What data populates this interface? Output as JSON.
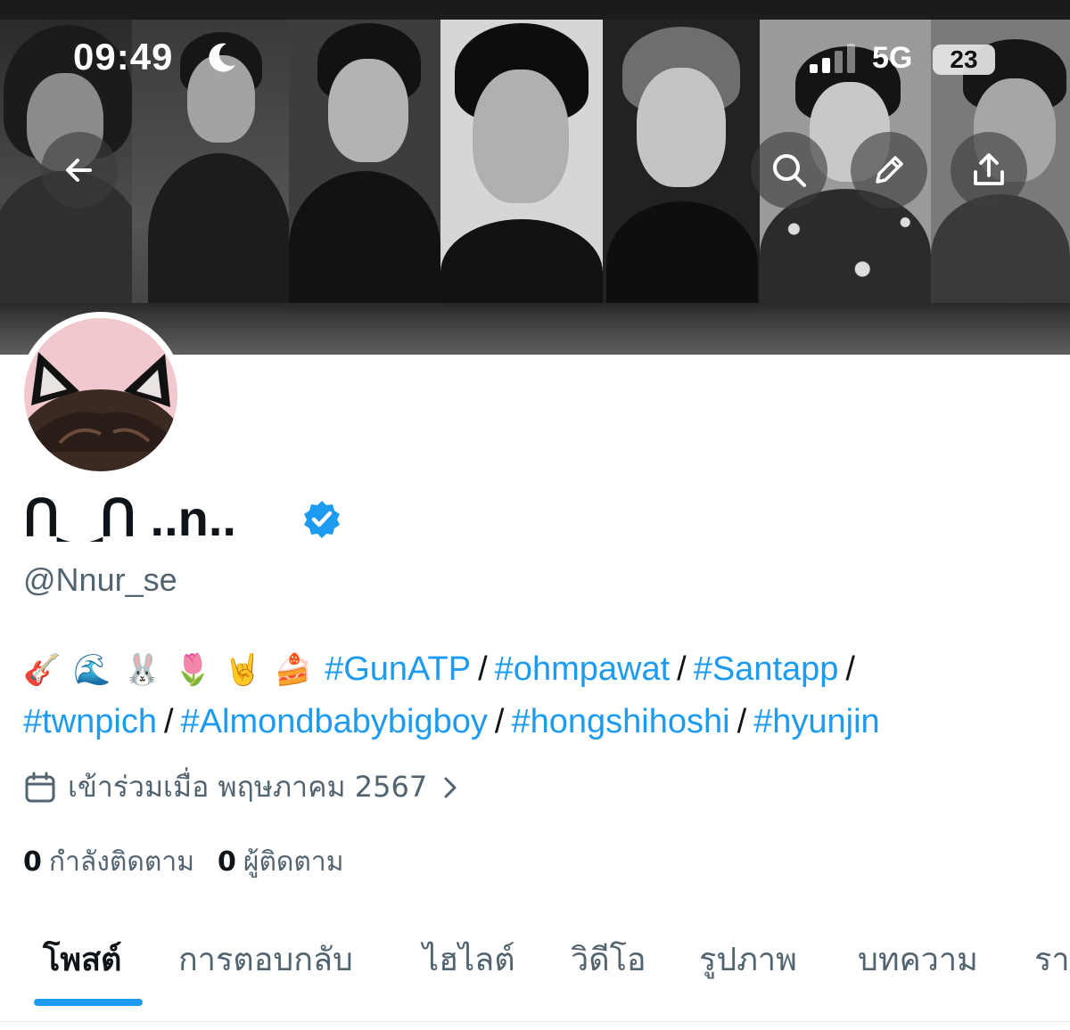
{
  "status_bar": {
    "time": "09:49",
    "network": "5G",
    "battery": "23"
  },
  "banner": {
    "style": "grayscale photo collage",
    "icons": [
      "back-arrow-icon",
      "search-icon",
      "pencil-icon",
      "share-icon"
    ]
  },
  "profile": {
    "display_name": "ᑎ‿ᑎ ..n..",
    "verified": true,
    "handle": "@Nnur_se",
    "bio": {
      "emojis": [
        "🎸",
        "🌊",
        "🐰",
        "🌷",
        "🤘",
        "🍰"
      ],
      "hashtags": [
        "#GunATP",
        "#ohmpawat",
        "#Santapp",
        "#twnpich",
        "#Almondbabybigboy",
        "#hongshihoshi",
        "#hyunjin"
      ],
      "separator": "/"
    },
    "joined": "เข้าร่วมเมื่อ พฤษภาคม 2567",
    "following_count": "0",
    "following_label": "กำลังติดตาม",
    "followers_count": "0",
    "followers_label": "ผู้ติดตาม"
  },
  "tabs": [
    {
      "label": "โพสต์",
      "active": true
    },
    {
      "label": "การตอบกลับ",
      "active": false
    },
    {
      "label": "ไฮไลต์",
      "active": false
    },
    {
      "label": "วิดีโอ",
      "active": false
    },
    {
      "label": "รูปภาพ",
      "active": false
    },
    {
      "label": "บทความ",
      "active": false
    },
    {
      "label": "รา",
      "active": false
    }
  ],
  "colors": {
    "accent": "#1d9bf0",
    "text_primary": "#0f1419",
    "text_secondary": "#536471",
    "avatar_bg": "#f1c8cd"
  }
}
